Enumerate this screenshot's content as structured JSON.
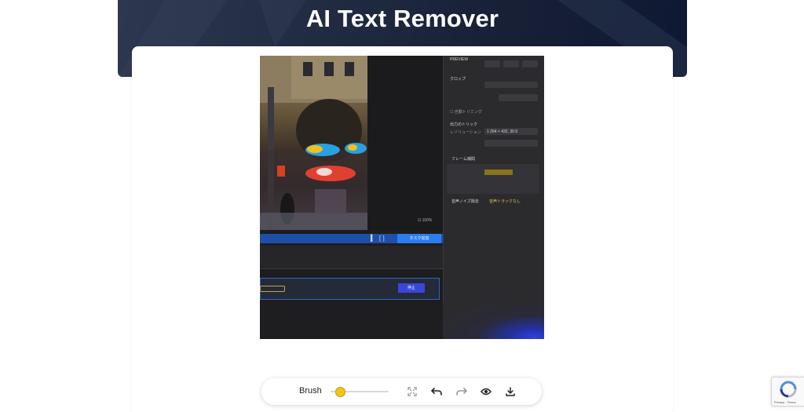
{
  "hero": {
    "title": "AI Text Remover"
  },
  "editor": {
    "panel": {
      "heading": "PREVIEW",
      "crop_label": "クロップ",
      "checkbox_label": "自動トリミング",
      "output_label": "出力のトリック",
      "resolution_label": "レゾリューション",
      "resolution_value": "1 264 × 432, 30.9",
      "frame_label": "フレーム補間",
      "audio_label": "音声ノイズ除去",
      "audio_value": "音声トラックなし"
    },
    "zoom_readout": "100%",
    "task_button": "タスク追加",
    "stop_button": "停止"
  },
  "toolbar": {
    "brush_label": "Brush",
    "brush_level": 0.1,
    "icons": [
      "fullscreen-icon",
      "undo-icon",
      "redo-icon",
      "eye-icon",
      "download-icon"
    ]
  },
  "recaptcha": {
    "text": "Privacy - Terms"
  }
}
